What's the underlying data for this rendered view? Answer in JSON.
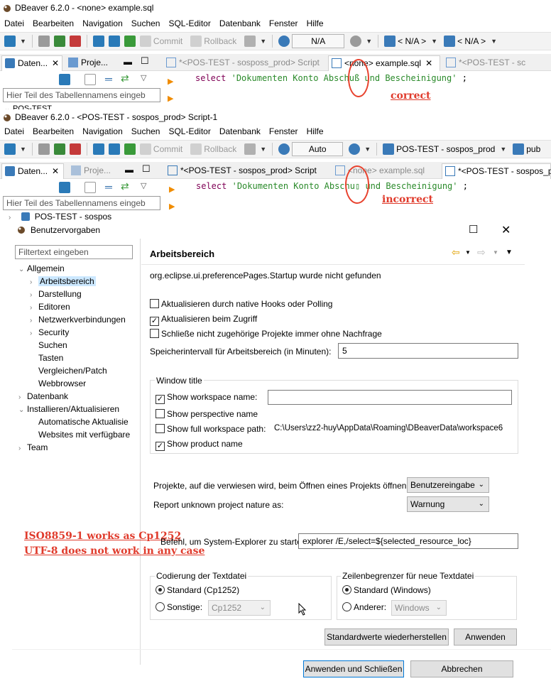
{
  "top_window": {
    "title": "DBeaver 6.2.0 - <none> example.sql",
    "menu": [
      "Datei",
      "Bearbeiten",
      "Navigation",
      "Suchen",
      "SQL-Editor",
      "Datenbank",
      "Fenster",
      "Hilfe"
    ],
    "toolbar": {
      "commit": "Commit",
      "rollback": "Rollback",
      "tx_mode": "N/A",
      "datasource": "< N/A >",
      "schema": "< N/A >"
    },
    "view_tabs": [
      "Daten...",
      "Proje..."
    ],
    "editor_tabs": [
      "*<POS-TEST - sosposs_prod> Script",
      "<none> example.sql",
      "*<POS-TEST - sc"
    ],
    "code": {
      "keyword": "select",
      "string": "'Dokumenten Konto Abschuß und Bescheinigung'",
      "end": ";"
    },
    "filter_placeholder": "Hier Teil des Tabellennamens eingeb",
    "tree_item": "POS-TEST",
    "annotation": "correct"
  },
  "bottom_window": {
    "title": "DBeaver 6.2.0 - <POS-TEST - sospos_prod> Script-1",
    "menu": [
      "Datei",
      "Bearbeiten",
      "Navigation",
      "Suchen",
      "SQL-Editor",
      "Datenbank",
      "Fenster",
      "Hilfe"
    ],
    "toolbar": {
      "commit": "Commit",
      "rollback": "Rollback",
      "tx_mode": "Auto",
      "datasource": "POS-TEST - sospos_prod",
      "schema": "pub"
    },
    "view_tabs": [
      "Daten...",
      "Proje..."
    ],
    "editor_tabs": [
      "*<POS-TEST - sospos_prod> Script",
      "<none> example.sql",
      "*<POS-TEST - sospos_pr"
    ],
    "code": {
      "keyword": "select",
      "string_before": "'Dokumenten Konto Abschu",
      "bad_char": "▯",
      "string_after": " und Bescheinigung'",
      "end": ";"
    },
    "filter_placeholder": "Hier Teil des Tabellennamens eingeb",
    "tree_item": "POS-TEST - sospos",
    "annotation": "incorrect"
  },
  "preferences": {
    "title": "Benutzervorgaben",
    "filter_placeholder": "Filtertext eingeben",
    "tree": [
      {
        "label": "Allgemein",
        "level": 0,
        "chevron": "open"
      },
      {
        "label": "Arbeitsbereich",
        "level": 1,
        "chevron": "closed",
        "selected": true
      },
      {
        "label": "Darstellung",
        "level": 1,
        "chevron": "closed"
      },
      {
        "label": "Editoren",
        "level": 1,
        "chevron": "closed"
      },
      {
        "label": "Netzwerkverbindungen",
        "level": 1,
        "chevron": "closed"
      },
      {
        "label": "Security",
        "level": 1,
        "chevron": "closed"
      },
      {
        "label": "Suchen",
        "level": 1,
        "chevron": "none"
      },
      {
        "label": "Tasten",
        "level": 1,
        "chevron": "none"
      },
      {
        "label": "Vergleichen/Patch",
        "level": 1,
        "chevron": "none"
      },
      {
        "label": "Webbrowser",
        "level": 1,
        "chevron": "none"
      },
      {
        "label": "Datenbank",
        "level": 0,
        "chevron": "closed"
      },
      {
        "label": "Installieren/Aktualisieren",
        "level": 0,
        "chevron": "open"
      },
      {
        "label": "Automatische Aktualisie",
        "level": 1,
        "chevron": "none"
      },
      {
        "label": "Websites mit verfügbare",
        "level": 1,
        "chevron": "none"
      },
      {
        "label": "Team",
        "level": 0,
        "chevron": "closed"
      }
    ],
    "page_title": "Arbeitsbereich",
    "error": "org.eclipse.ui.preferencePages.Startup wurde nicht gefunden",
    "options": [
      {
        "label": "Aktualisieren durch native Hooks oder Polling",
        "checked": false
      },
      {
        "label": "Aktualisieren beim Zugriff",
        "checked": true
      },
      {
        "label": "Schließe nicht zugehörige Projekte immer ohne Nachfrage",
        "checked": false
      }
    ],
    "save_interval_label": "Speicherintervall für Arbeitsbereich (in Minuten):",
    "save_interval_value": "5",
    "window_title_group": "Window title",
    "wt_options": [
      {
        "label": "Show workspace name:",
        "checked": true
      },
      {
        "label": "Show perspective name",
        "checked": false
      },
      {
        "label": "Show full workspace path:",
        "checked": false,
        "value": "C:\\Users\\zz2-huy\\AppData\\Roaming\\DBeaverData\\workspace6"
      },
      {
        "label": "Show product name",
        "checked": true
      }
    ],
    "workspace_name_value": "",
    "open_referenced_label": "Projekte, auf die verwiesen wird, beim Öffnen eines Projekts öffnen",
    "open_referenced_value": "Benutzereingabe",
    "unknown_nature_label": "Report unknown project nature as:",
    "unknown_nature_value": "Warnung",
    "explorer_label": "Befehl, um System-Explorer zu starten",
    "explorer_value": "explorer /E,/select=${selected_resource_loc}",
    "annotation_line1": "ISO8859-1 works as Cp1252",
    "annotation_line2": "UTF-8 does not work in any case",
    "encoding_group": "Codierung der Textdatei",
    "encoding_default": "Standard (Cp1252)",
    "encoding_other": "Sonstige:",
    "encoding_other_value": "Cp1252",
    "line_delim_group": "Zeilenbegrenzer für neue Textdatei",
    "line_default": "Standard (Windows)",
    "line_other": "Anderer:",
    "line_other_value": "Windows",
    "restore_defaults": "Standardwerte wiederherstellen",
    "apply": "Anwenden",
    "apply_close": "Anwenden und Schließen",
    "cancel": "Abbrechen"
  },
  "colors": {
    "annotation": "#e03b2c",
    "keyword": "#7f0055",
    "string": "#2a8a2a",
    "selected_row": "#cce8ff"
  }
}
